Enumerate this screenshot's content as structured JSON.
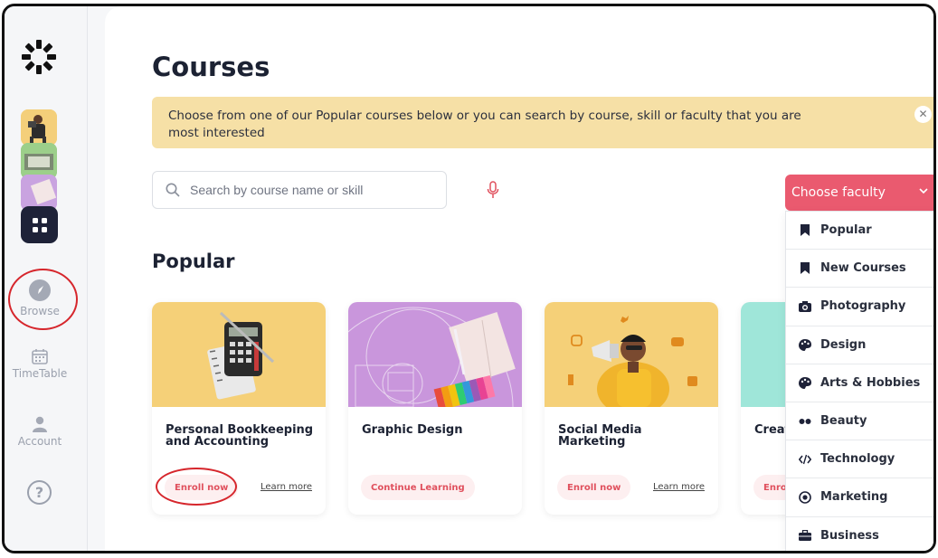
{
  "sidebar": {
    "nav": [
      {
        "label": "Browse",
        "icon": "compass-icon"
      },
      {
        "label": "TimeTable",
        "icon": "calendar-icon"
      },
      {
        "label": "Account",
        "icon": "user-icon"
      }
    ],
    "help_label": "?"
  },
  "main": {
    "title": "Courses",
    "banner_text": "Choose from one of our Popular courses below or you can search by course, skill or faculty that you are most interested",
    "search_placeholder": "Search by course name or skill",
    "section_title": "Popular"
  },
  "courses": [
    {
      "title": "Personal Bookkeeping and Accounting",
      "action": "Enroll now",
      "learn": "Learn more",
      "color": "#f5d078"
    },
    {
      "title": "Graphic Design",
      "action": "Continue Learning",
      "learn": "",
      "color": "#c996dc"
    },
    {
      "title": "Social Media Marketing",
      "action": "Enroll now",
      "learn": "Learn more",
      "color": "#f5d078"
    },
    {
      "title": "Creat",
      "action": "Enrol",
      "learn": "",
      "color": "#9fe6d9"
    }
  ],
  "faculty": {
    "button_label": "Choose faculty",
    "items": [
      {
        "label": "Popular",
        "icon": "bookmark-icon"
      },
      {
        "label": "New Courses",
        "icon": "bookmark-icon"
      },
      {
        "label": "Photography",
        "icon": "camera-icon"
      },
      {
        "label": "Design",
        "icon": "palette-icon"
      },
      {
        "label": "Arts & Hobbies",
        "icon": "palette-icon"
      },
      {
        "label": "Beauty",
        "icon": "dots-icon"
      },
      {
        "label": "Technology",
        "icon": "code-icon"
      },
      {
        "label": "Marketing",
        "icon": "target-icon"
      },
      {
        "label": "Business",
        "icon": "briefcase-icon"
      }
    ]
  },
  "colors": {
    "accent": "#ea5a6f",
    "banner": "#f6e0a6",
    "dark": "#1e2238",
    "annotation_ring": "#d6262c"
  }
}
